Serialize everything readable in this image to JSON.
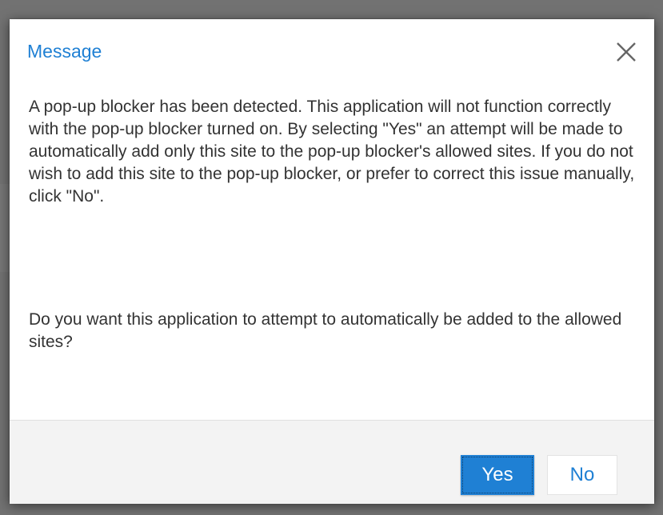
{
  "dialog": {
    "title": "Message",
    "close_icon": "close-icon",
    "message": "A pop-up blocker has been detected. This application will not function correctly with the pop-up blocker turned on. By selecting \"Yes\" an attempt will be made to automatically add only this site to the pop-up blocker's allowed sites. If you do not wish to add this site to the pop-up blocker, or prefer to correct this issue manually, click \"No\".",
    "question": "Do you want this application to attempt to automatically be added to the allowed sites?",
    "buttons": {
      "yes_label": "Yes",
      "no_label": "No"
    }
  },
  "colors": {
    "accent": "#1f80d4",
    "backdrop": "#727272",
    "footer_bg": "#f3f3f3",
    "body_text": "#333333"
  }
}
